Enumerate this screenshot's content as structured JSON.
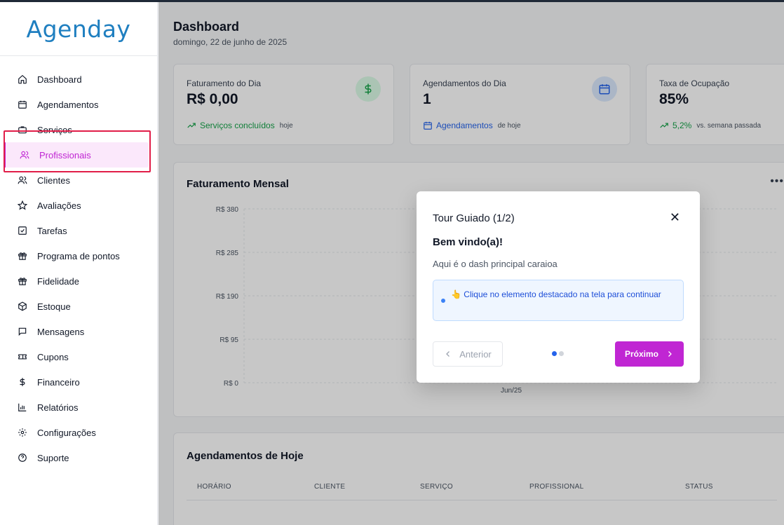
{
  "app": {
    "logo": "Agenday"
  },
  "sidebar": {
    "items": [
      {
        "label": "Dashboard",
        "icon": "home-icon"
      },
      {
        "label": "Agendamentos",
        "icon": "calendar-icon"
      },
      {
        "label": "Serviços",
        "icon": "briefcase-icon"
      },
      {
        "label": "Profissionais",
        "icon": "users-icon",
        "active": true
      },
      {
        "label": "Clientes",
        "icon": "users-icon"
      },
      {
        "label": "Avaliações",
        "icon": "star-icon"
      },
      {
        "label": "Tarefas",
        "icon": "checkbox-icon"
      },
      {
        "label": "Programa de pontos",
        "icon": "gift-icon"
      },
      {
        "label": "Fidelidade",
        "icon": "gift-icon"
      },
      {
        "label": "Estoque",
        "icon": "box-icon"
      },
      {
        "label": "Mensagens",
        "icon": "message-icon"
      },
      {
        "label": "Cupons",
        "icon": "ticket-icon"
      },
      {
        "label": "Financeiro",
        "icon": "dollar-icon"
      },
      {
        "label": "Relatórios",
        "icon": "bar-chart-icon"
      },
      {
        "label": "Configurações",
        "icon": "gear-icon"
      },
      {
        "label": "Suporte",
        "icon": "help-circle-icon"
      }
    ]
  },
  "header": {
    "title": "Dashboard",
    "date": "domingo, 22 de junho de 2025"
  },
  "cards": [
    {
      "label": "Faturamento do Dia",
      "value": "R$ 0,00",
      "foot": "Serviços concluídos",
      "foot_muted": "hoje",
      "icon": "dollar-icon"
    },
    {
      "label": "Agendamentos do Dia",
      "value": "1",
      "foot": "Agendamentos",
      "foot_muted": "de hoje",
      "icon": "calendar-icon"
    },
    {
      "label": "Taxa de Ocupação",
      "value": "85%",
      "foot": "5,2%",
      "foot_muted": "vs. semana passada",
      "icon": "trending-up-icon"
    }
  ],
  "chart_data": {
    "type": "bar",
    "title": "Faturamento Mensal",
    "categories": [
      "Jun/25"
    ],
    "values": [
      0
    ],
    "ylim": [
      0,
      380
    ],
    "yticks": [
      0,
      95,
      190,
      285,
      380
    ],
    "ytick_labels": [
      "R$ 0",
      "R$ 95",
      "R$ 190",
      "R$ 285",
      "R$ 380"
    ],
    "grid": true
  },
  "table": {
    "title": "Agendamentos de Hoje",
    "columns": [
      "HORÁRIO",
      "CLIENTE",
      "SERVIÇO",
      "PROFISSIONAL",
      "STATUS"
    ]
  },
  "tour": {
    "title": "Tour Guiado (1/2)",
    "heading": "Bem vindo(a)!",
    "text": "Aqui é o dash principal caraioa",
    "hint": "👆 Clique no elemento destacado na tela para continuar",
    "prev_label": "Anterior",
    "next_label": "Próximo",
    "step": 1,
    "steps": 2
  },
  "colors": {
    "brand": "#1f7fc0",
    "accent": "#c026d3",
    "highlight": "#e11d48",
    "success": "#16a34a",
    "info": "#2563eb"
  }
}
